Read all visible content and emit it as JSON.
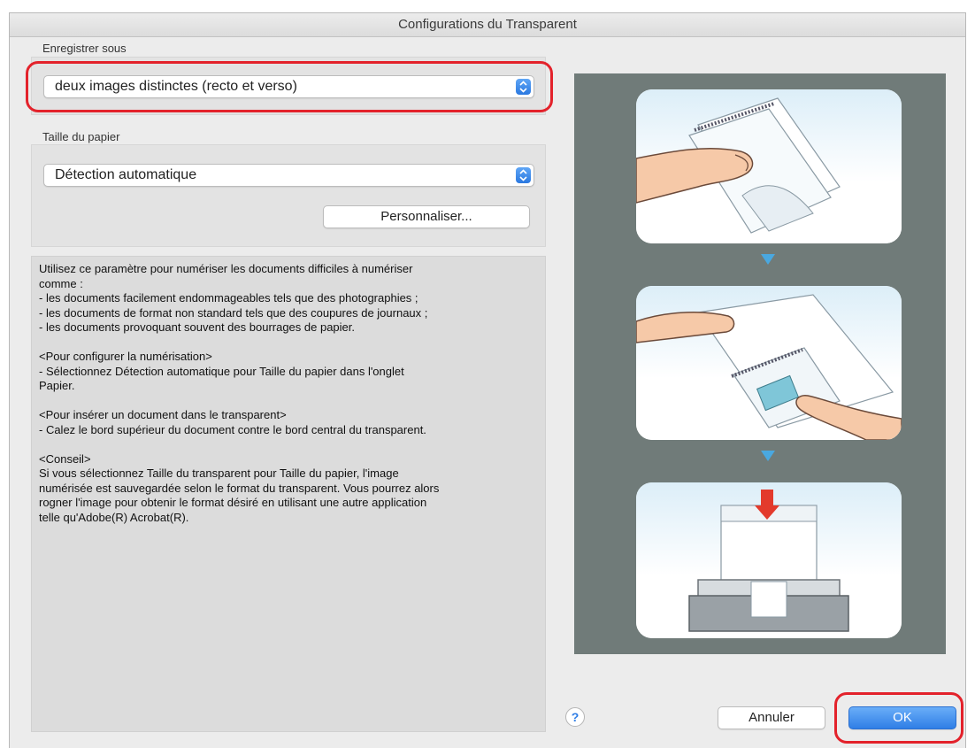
{
  "window": {
    "title": "Configurations du Transparent"
  },
  "save_as": {
    "label": "Enregistrer sous",
    "selected": "deux images distinctes (recto et verso)"
  },
  "paper_size": {
    "label": "Taille du papier",
    "selected": "Détection automatique",
    "customize_label": "Personnaliser..."
  },
  "description": {
    "lines": [
      "Utilisez ce paramètre pour numériser les documents difficiles à numériser",
      "comme :",
      "- les documents facilement endommageables tels que des photographies ;",
      "- les documents de format non standard tels que des coupures de journaux ;",
      "- les documents provoquant souvent des bourrages de papier.",
      "",
      "<Pour configurer la numérisation>",
      "- Sélectionnez Détection automatique pour Taille du papier dans l'onglet",
      "Papier.",
      "",
      "<Pour insérer un document dans le transparent>",
      "- Calez le bord supérieur du document contre le bord central du transparent.",
      "",
      "<Conseil>",
      "Si vous sélectionnez Taille du transparent pour Taille du papier, l'image",
      "numérisée est sauvegardée selon le format du transparent. Vous pourrez alors",
      "rogner l'image pour obtenir le format désiré en utilisant une autre application",
      "telle qu'Adobe(R) Acrobat(R)."
    ]
  },
  "footer": {
    "help_label": "?",
    "cancel_label": "Annuler",
    "ok_label": "OK"
  },
  "colors": {
    "accent": "#2f7ee6",
    "highlight_ring": "#e3222b",
    "illustration_bg": "#707b79",
    "arrow": "#4aa8e0"
  }
}
